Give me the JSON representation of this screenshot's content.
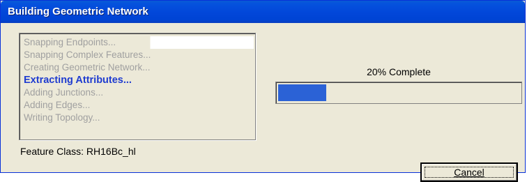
{
  "window": {
    "title": "Building Geometric Network"
  },
  "steps": [
    {
      "label": "Snapping Endpoints...",
      "state": "done"
    },
    {
      "label": "Snapping Complex Features...",
      "state": "pending"
    },
    {
      "label": "Creating Geometric Network...",
      "state": "pending"
    },
    {
      "label": "Extracting Attributes...",
      "state": "active"
    },
    {
      "label": "Adding Junctions...",
      "state": "pending"
    },
    {
      "label": "Adding Edges...",
      "state": "pending"
    },
    {
      "label": "Writing Topology...",
      "state": "pending"
    }
  ],
  "feature_class": {
    "label": "Feature Class: RH16Bc_hl"
  },
  "progress": {
    "text": "20% Complete",
    "value": 0.2
  },
  "buttons": {
    "cancel_label": "Cancel"
  },
  "colors": {
    "title_bar": "#0246d9",
    "active_step": "#1f3cd0",
    "progress_fill": "#2b62d6",
    "dialog_bg": "#ece9d8"
  }
}
